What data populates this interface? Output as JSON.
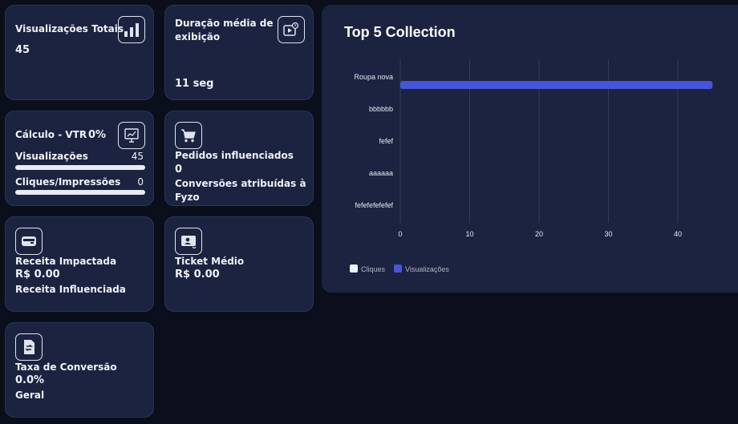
{
  "cards": {
    "views_total": {
      "title": "Visualizações Totais",
      "value": "45",
      "icon": "bar-chart-icon"
    },
    "avg_duration": {
      "title_line1": "Duração média de",
      "title_line2": "exibição",
      "value": "11 seg",
      "icon": "play-clock-icon"
    },
    "vtr": {
      "title": "Cálculo - VTR",
      "percent": "0%",
      "icon": "monitor-chart-icon",
      "rows": [
        {
          "label": "Visualizações",
          "value": "45",
          "fill": 1.0
        },
        {
          "label": "Cliques/Impressões",
          "value": "0",
          "fill": 1.0
        }
      ]
    },
    "orders": {
      "icon": "cart-icon",
      "title": "Pedidos influenciados",
      "value": "0",
      "subtitle": "Conversões atribuídas à Fyzo"
    },
    "revenue": {
      "icon": "wallet-icon",
      "title": "Receita Impactada",
      "value": "R$ 0.00",
      "subtitle": "Receita Influenciada"
    },
    "ticket": {
      "icon": "ticket-user-icon",
      "title": "Ticket Médio",
      "value": "R$ 0.00"
    },
    "conversion": {
      "icon": "document-exchange-icon",
      "title": "Taxa de Conversão",
      "value": "0.0%",
      "subtitle": "Geral"
    }
  },
  "chart_data": {
    "type": "bar",
    "orientation": "horizontal",
    "title": "Top 5 Collection",
    "categories": [
      "Roupa nova",
      "bbbbbb",
      "fefef",
      "aaaaaa",
      "fefefefefefef"
    ],
    "series": [
      {
        "name": "Cliques",
        "values": [
          0,
          0,
          0,
          0,
          0
        ],
        "color": "#e6f4fb"
      },
      {
        "name": "Visualizações",
        "values": [
          45,
          0,
          0,
          0,
          0
        ],
        "color": "#4655d9"
      }
    ],
    "xticks": [
      0,
      10,
      20,
      30,
      40
    ],
    "xlim": [
      0,
      48
    ],
    "grid": true,
    "legend": "bottom-left"
  }
}
